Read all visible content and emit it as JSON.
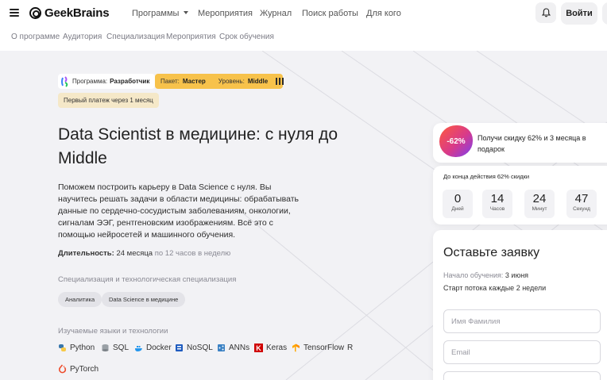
{
  "header": {
    "logo_text": "GeekBrains",
    "nav": [
      "Программы",
      "Мероприятия",
      "Журнал",
      "Поиск работы",
      "Для кого"
    ],
    "login_label": "Войти"
  },
  "subnav": [
    "О программе",
    "Аудитория",
    "Специализация",
    "Мероприятия",
    "Срок обучения"
  ],
  "badges": {
    "program_prefix": "Программа:",
    "program_value": "Разработчик",
    "package_prefix": "Пакет:",
    "package_value": "Мастер",
    "level_prefix": "Уровень:",
    "level_value": "Middle",
    "first_payment": "Первый платеж через 1 месяц"
  },
  "hero": {
    "title": "Data Scientist в медицине: с нуля до Middle",
    "description": "Поможем построить карьеру в Data Science с нуля. Вы научитесь решать задачи в области медицины: обрабатывать данные по сердечно-сосудистым заболеваниям, онкологии, сигналам ЭЭГ, рентгеновским изображениям. Всё это с помощью нейросетей и машинного обучения.",
    "duration_label": "Длительность:",
    "duration_value": "24 месяца",
    "duration_note": "по 12 часов в неделю",
    "spec_label": "Специализация и технологическая специализация",
    "spec_pills": [
      "Аналитика",
      "Data Science в медицине"
    ],
    "tech_label": "Изучаемые языки и технологии",
    "tech": [
      "Python",
      "SQL",
      "Docker",
      "NoSQL",
      "ANNs",
      "Keras",
      "TensorFlow",
      "R",
      "PyTorch"
    ]
  },
  "discount": {
    "badge": "-62%",
    "text": "Получи скидку 62% и 3 месяца в подарок"
  },
  "timer": {
    "title": "До конца действия 62% скидки",
    "days": "0",
    "days_label": "Дней",
    "hours": "14",
    "hours_label": "Часов",
    "minutes": "24",
    "minutes_label": "Минут",
    "seconds": "47",
    "seconds_label": "Секунд"
  },
  "form": {
    "title": "Оставьте заявку",
    "start_label": "Начало обучения:",
    "start_value": "3 июня",
    "stream_note": "Старт потока каждые 2 недели",
    "name_placeholder": "Имя Фамилия",
    "email_placeholder": "Email"
  },
  "colors": {
    "package_badge": "#f7c24b",
    "first_payment_badge": "#f5e8c8",
    "page_bg": "#f2f2f5"
  }
}
